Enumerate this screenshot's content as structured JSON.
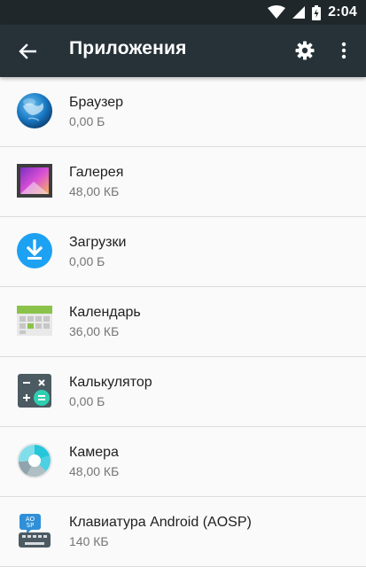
{
  "status_bar": {
    "time": "2:04",
    "icons": [
      "wifi-icon",
      "signal-icon",
      "battery-charging-icon"
    ]
  },
  "toolbar": {
    "title": "Приложения",
    "back_icon": "arrow-back-icon",
    "settings_icon": "gear-icon",
    "more_icon": "more-vert-icon"
  },
  "apps": [
    {
      "name": "Браузер",
      "size": "0,00 Б",
      "icon": "browser-globe-icon"
    },
    {
      "name": "Галерея",
      "size": "48,00 КБ",
      "icon": "gallery-icon"
    },
    {
      "name": "Загрузки",
      "size": "0,00 Б",
      "icon": "downloads-icon"
    },
    {
      "name": "Календарь",
      "size": "36,00 КБ",
      "icon": "calendar-icon"
    },
    {
      "name": "Калькулятор",
      "size": "0,00 Б",
      "icon": "calculator-icon"
    },
    {
      "name": "Камера",
      "size": "48,00 КБ",
      "icon": "camera-icon"
    },
    {
      "name": "Клавиатура Android (AOSP)",
      "size": "140 КБ",
      "icon": "keyboard-icon"
    }
  ]
}
